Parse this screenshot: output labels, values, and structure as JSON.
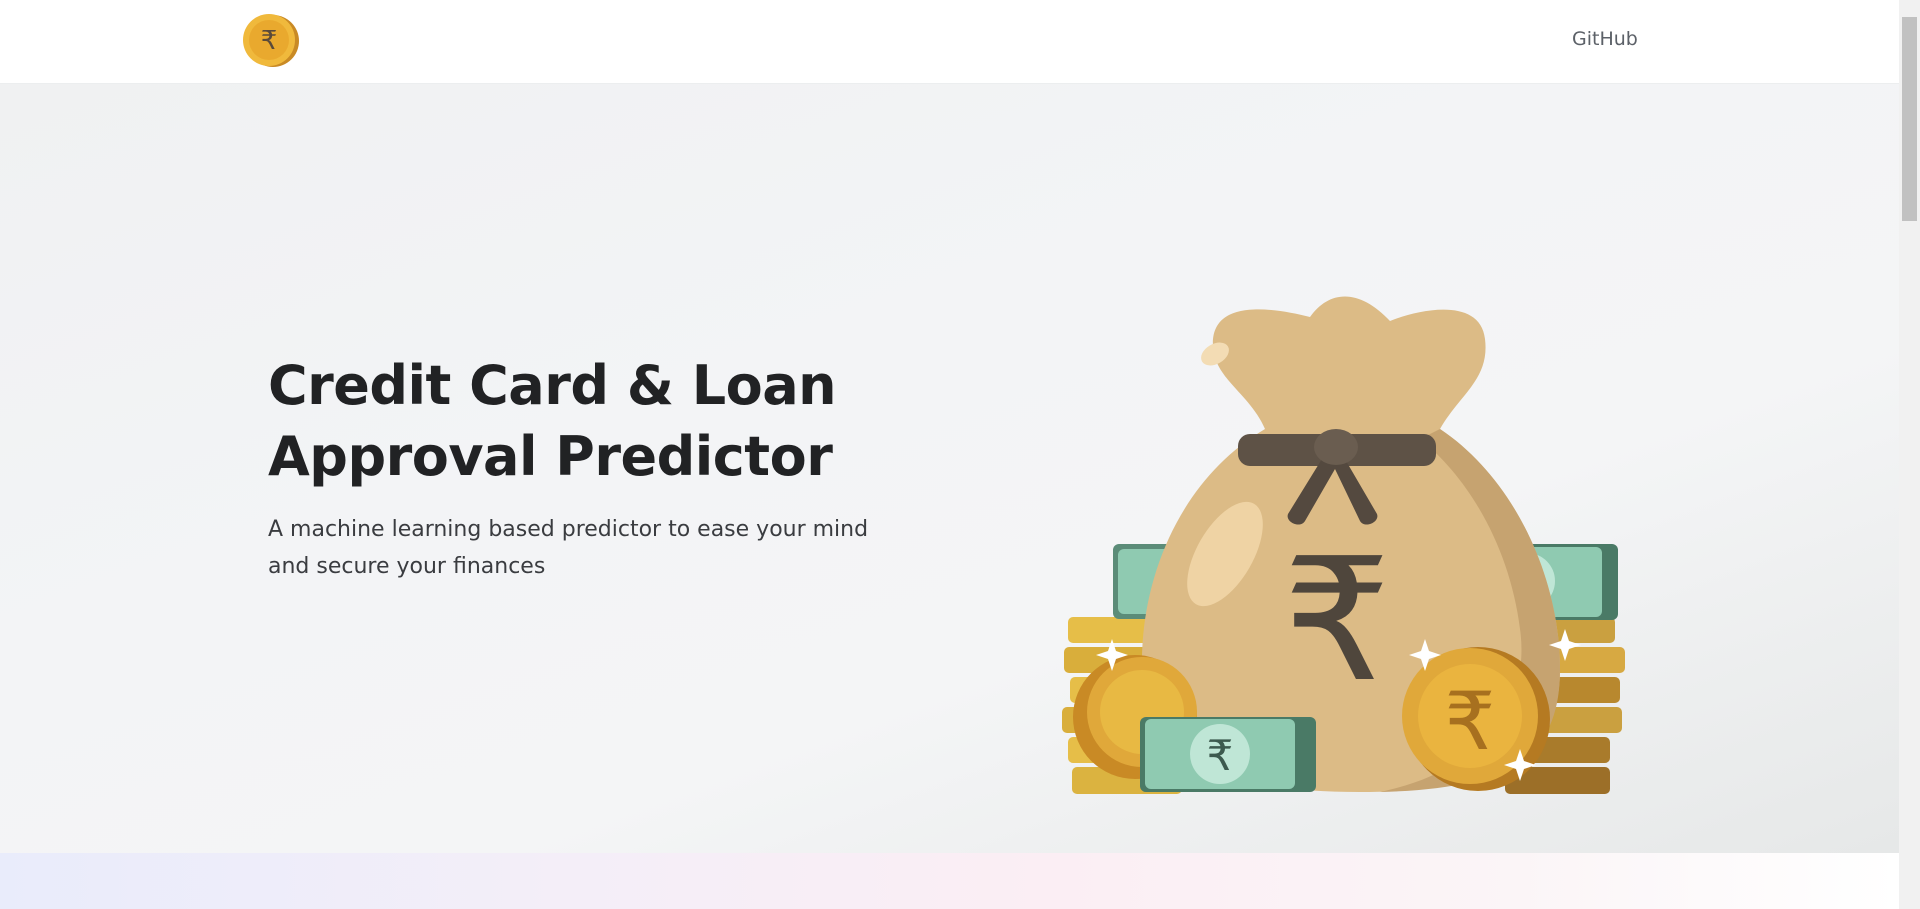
{
  "nav": {
    "logo_icon": "rupee-coin-icon",
    "github_label": "GitHub"
  },
  "hero": {
    "title": "Credit Card & Loan Approval Predictor",
    "subtitle": "A machine learning based predictor to ease your mind and secure your finances",
    "illustration_icon": "rupee-money-bag-icon"
  },
  "colors": {
    "coin_gold": "#e0a83a",
    "bag_tan": "#dcbb86",
    "note_green": "#8fcab1",
    "text_dark": "#212224"
  }
}
